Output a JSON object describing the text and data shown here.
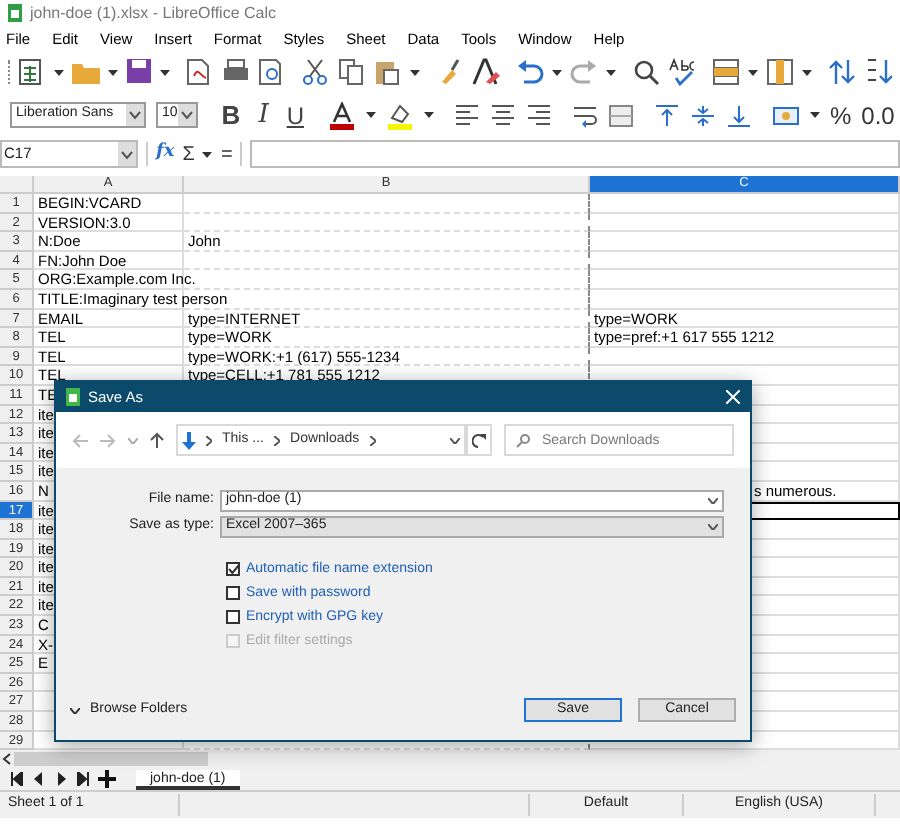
{
  "window": {
    "title": "john-doe (1).xlsx - LibreOffice Calc"
  },
  "menu": [
    "File",
    "Edit",
    "View",
    "Insert",
    "Format",
    "Styles",
    "Sheet",
    "Data",
    "Tools",
    "Window",
    "Help"
  ],
  "font_toolbar": {
    "font_name": "Liberation Sans",
    "font_size": "10",
    "bold": "B",
    "italic": "I",
    "underline": "U",
    "percent": "%",
    "decimal": "0.0"
  },
  "formula_bar": {
    "name_box": "C17",
    "function_wizard": "fx",
    "sum": "Σ",
    "equals": "="
  },
  "columns": [
    {
      "label": "A",
      "selected": false
    },
    {
      "label": "B",
      "selected": false
    },
    {
      "label": "C",
      "selected": true
    }
  ],
  "rows": [
    {
      "number": "1",
      "selected": false,
      "a": "BEGIN:VCARD"
    },
    {
      "number": "2",
      "selected": false,
      "a": "VERSION:3.0"
    },
    {
      "number": "3",
      "selected": false,
      "a": "N:Doe",
      "b": "John"
    },
    {
      "number": "4",
      "selected": false,
      "a": "FN:John Doe"
    },
    {
      "number": "5",
      "selected": false,
      "a": "ORG:Example.com Inc."
    },
    {
      "number": "6",
      "selected": false,
      "a": "TITLE:Imaginary test person"
    },
    {
      "number": "7",
      "selected": false,
      "a": "EMAIL",
      "b": "type=INTERNET",
      "c": "type=WORK"
    },
    {
      "number": "8",
      "selected": false,
      "a": "TEL",
      "b": "type=WORK",
      "c": "type=pref:+1 617 555 1212"
    },
    {
      "number": "9",
      "selected": false,
      "a": "TEL",
      "b": "type=WORK:+1 (617) 555-1234"
    },
    {
      "number": "10",
      "selected": false,
      "a": "TEL",
      "b": "type=CELL:+1 781 555 1212"
    },
    {
      "number": "11",
      "selected": false,
      "a": "TE"
    },
    {
      "number": "12",
      "selected": false,
      "a": "ite"
    },
    {
      "number": "13",
      "selected": false,
      "a": "ite"
    },
    {
      "number": "14",
      "selected": false,
      "a": "ite"
    },
    {
      "number": "15",
      "selected": false,
      "a": "ite"
    },
    {
      "number": "16",
      "selected": false,
      "a": "N",
      "c": "s numerous.",
      "kind": "overflow"
    },
    {
      "number": "17",
      "selected": true,
      "a": "ite"
    },
    {
      "number": "18",
      "selected": false,
      "a": "ite"
    },
    {
      "number": "19",
      "selected": false,
      "a": "ite"
    },
    {
      "number": "20",
      "selected": false,
      "a": "ite"
    },
    {
      "number": "21",
      "selected": false,
      "a": "ite"
    },
    {
      "number": "22",
      "selected": false,
      "a": "ite"
    },
    {
      "number": "23",
      "selected": false,
      "a": "C"
    },
    {
      "number": "24",
      "selected": false,
      "a": "X-"
    },
    {
      "number": "25",
      "selected": false,
      "a": "E"
    },
    {
      "number": "26",
      "selected": false
    },
    {
      "number": "27",
      "selected": false
    },
    {
      "number": "28",
      "selected": false
    },
    {
      "number": "29",
      "selected": false
    }
  ],
  "dialog": {
    "title": "Save As",
    "breadcrumb": [
      "This ...",
      "Downloads"
    ],
    "search": {
      "placeholder": "Search Downloads"
    },
    "file_name": {
      "label": "File name:",
      "value": "john-doe (1)"
    },
    "save_as_type": {
      "label": "Save as type:",
      "value": "Excel 2007–365"
    },
    "options": [
      {
        "label": "Automatic file name extension",
        "checked": true,
        "disabled": false
      },
      {
        "label": "Save with password",
        "checked": false,
        "disabled": false
      },
      {
        "label": "Encrypt with GPG key",
        "checked": false,
        "disabled": false
      },
      {
        "label": "Edit filter settings",
        "checked": false,
        "disabled": true
      }
    ],
    "browse_folders": "Browse Folders",
    "buttons": [
      "Save",
      "Cancel"
    ]
  },
  "sheet_tabs": [
    {
      "label": "john-doe (1)",
      "selected": true
    }
  ],
  "status_bar": {
    "sheet": "Sheet 1 of 1",
    "style": "Default",
    "language": "English (USA)"
  }
}
